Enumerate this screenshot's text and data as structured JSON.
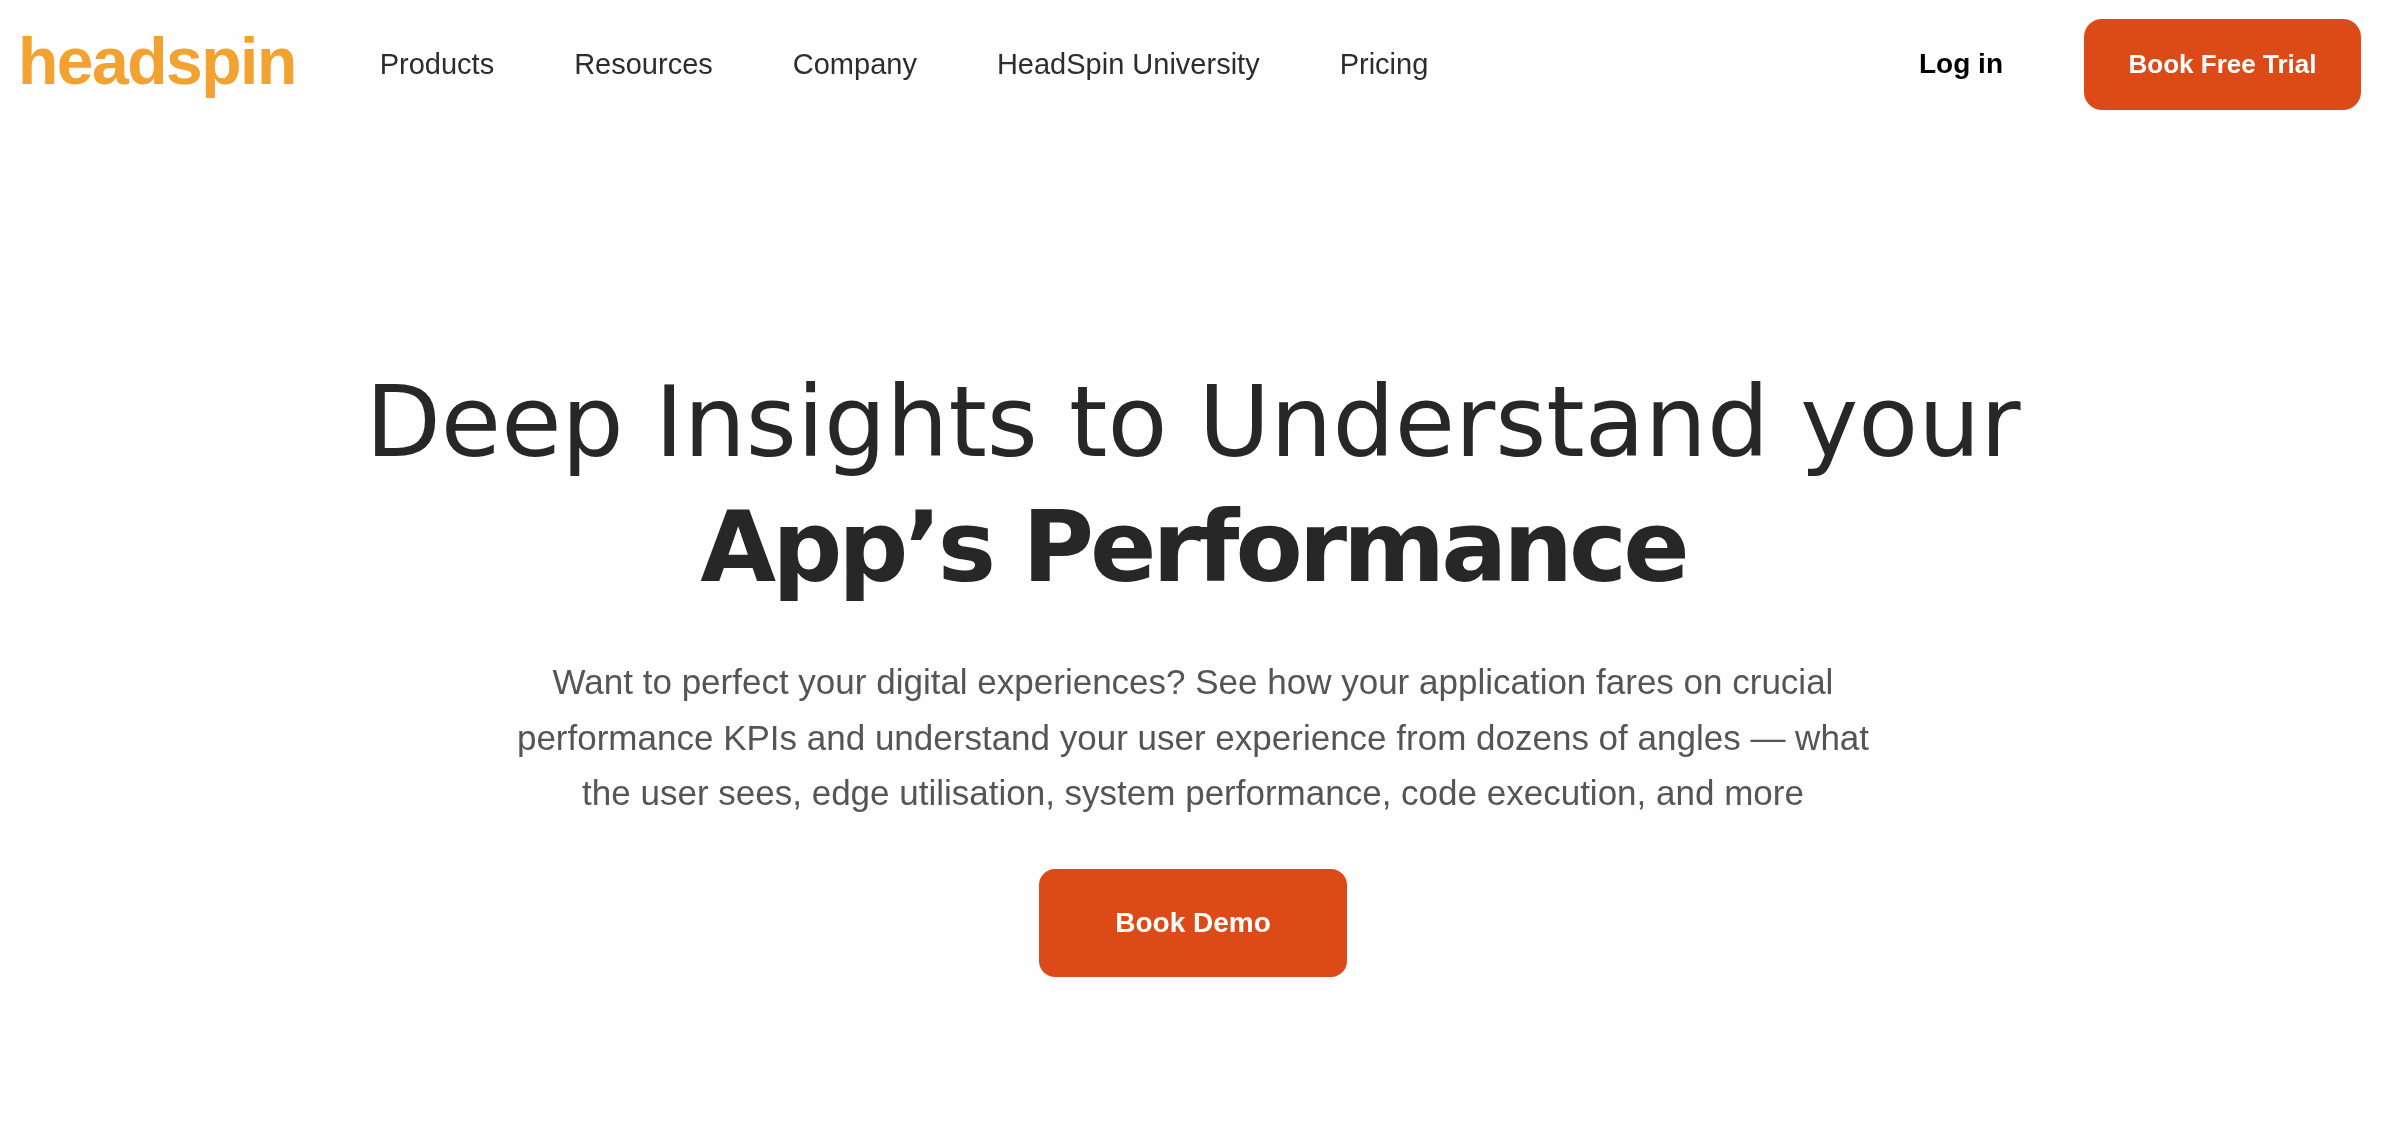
{
  "header": {
    "logo": "headspin",
    "nav": [
      "Products",
      "Resources",
      "Company",
      "HeadSpin University",
      "Pricing"
    ],
    "login": "Log in",
    "cta": "Book Free Trial"
  },
  "hero": {
    "headline": "Deep Insights to Understand your **App’s Performance**",
    "description": "Want to perfect your digital experiences? See how your application fares on crucial performance KPIs and understand your user experience from dozens of angles — what the user sees, edge utilisation, system performance, code execution, and more",
    "cta": "Book Demo"
  }
}
